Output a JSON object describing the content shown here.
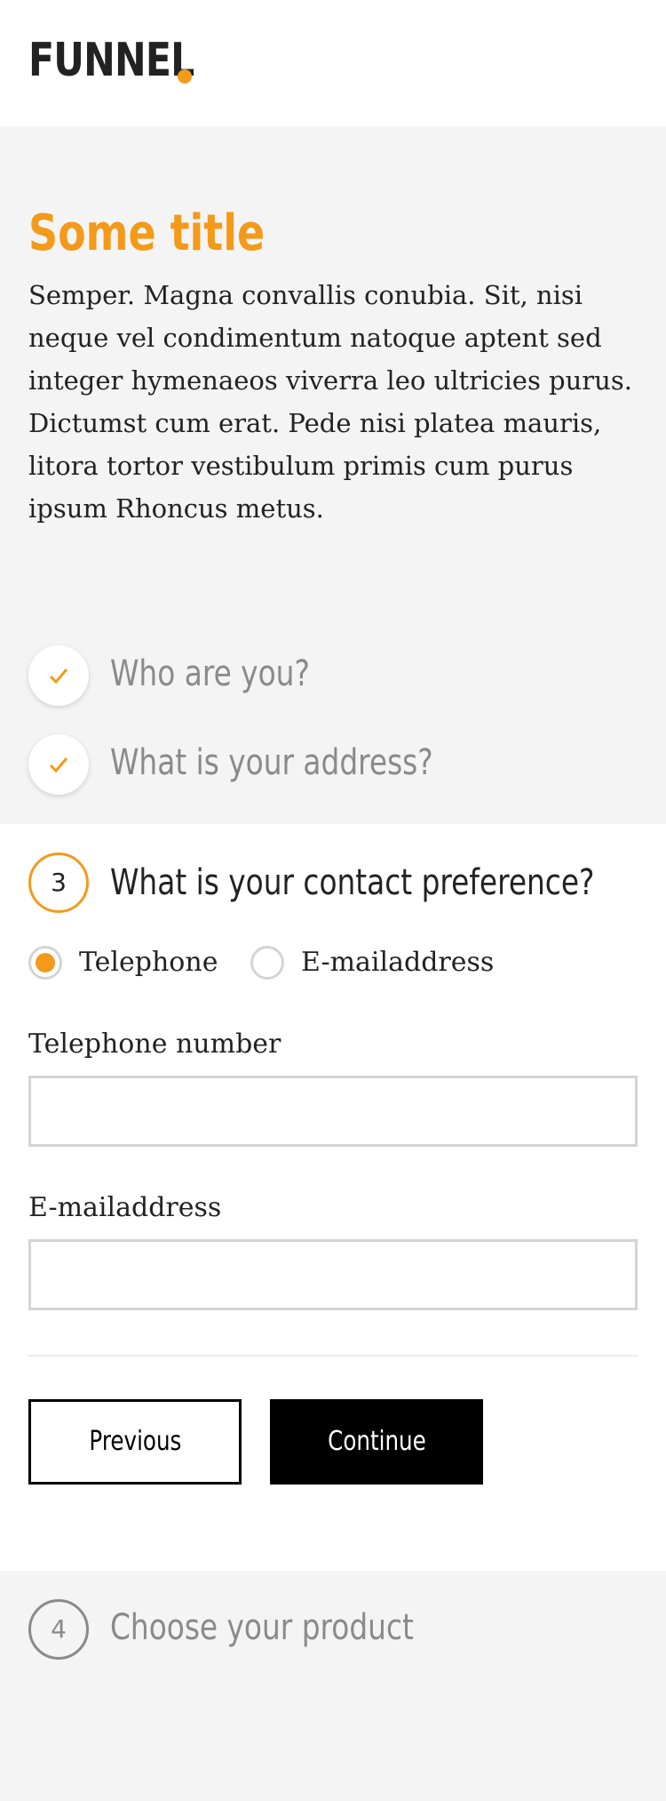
{
  "header": {
    "logo_text": "FUNNEL",
    "accent_color": "#f39a1b"
  },
  "intro": {
    "title": "Some title",
    "text": "Semper. Magna convallis conubia. Sit, nisi neque vel condimentum natoque aptent sed integer hymenaeos viverra leo ultricies purus. Dictumst cum erat. Pede nisi platea mauris, litora tortor vestibulum primis cum purus ipsum Rhoncus metus."
  },
  "steps": {
    "completed": [
      {
        "label": "Who are you?",
        "icon": "check-icon"
      },
      {
        "label": "What is your address?",
        "icon": "check-icon"
      }
    ],
    "active": {
      "number": "3",
      "title": "What is your contact preference?",
      "options": [
        {
          "label": "Telephone",
          "selected": true
        },
        {
          "label": "E-mailaddress",
          "selected": false
        }
      ],
      "fields": [
        {
          "label": "Telephone number",
          "value": "",
          "placeholder": ""
        },
        {
          "label": "E-mailaddress",
          "value": "",
          "placeholder": ""
        }
      ],
      "previous_label": "Previous",
      "continue_label": "Continue"
    },
    "upcoming": {
      "number": "4",
      "title": "Choose your product"
    }
  }
}
